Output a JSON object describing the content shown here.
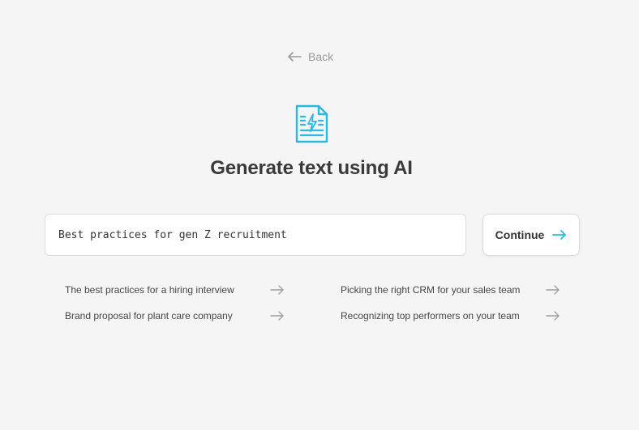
{
  "back": {
    "label": "Back"
  },
  "header": {
    "title": "Generate text using AI"
  },
  "prompt": {
    "value": "Best practices for gen Z recruitment",
    "placeholder": ""
  },
  "continue_button": {
    "label": "Continue"
  },
  "suggestions": [
    {
      "label": "The best practices for a hiring interview"
    },
    {
      "label": "Picking the right CRM for your sales team"
    },
    {
      "label": "Brand proposal for plant care company"
    },
    {
      "label": "Recognizing top performers on your team"
    }
  ],
  "colors": {
    "accent": "#2bb9e0",
    "background": "#f5f5f5",
    "muted_text": "#9a9a9a",
    "arrow_gray": "#a0a0a0"
  },
  "icons": {
    "back": "arrow-left-icon",
    "hero": "document-lightning-icon",
    "continue": "arrow-right-icon",
    "suggestion": "arrow-right-icon"
  }
}
